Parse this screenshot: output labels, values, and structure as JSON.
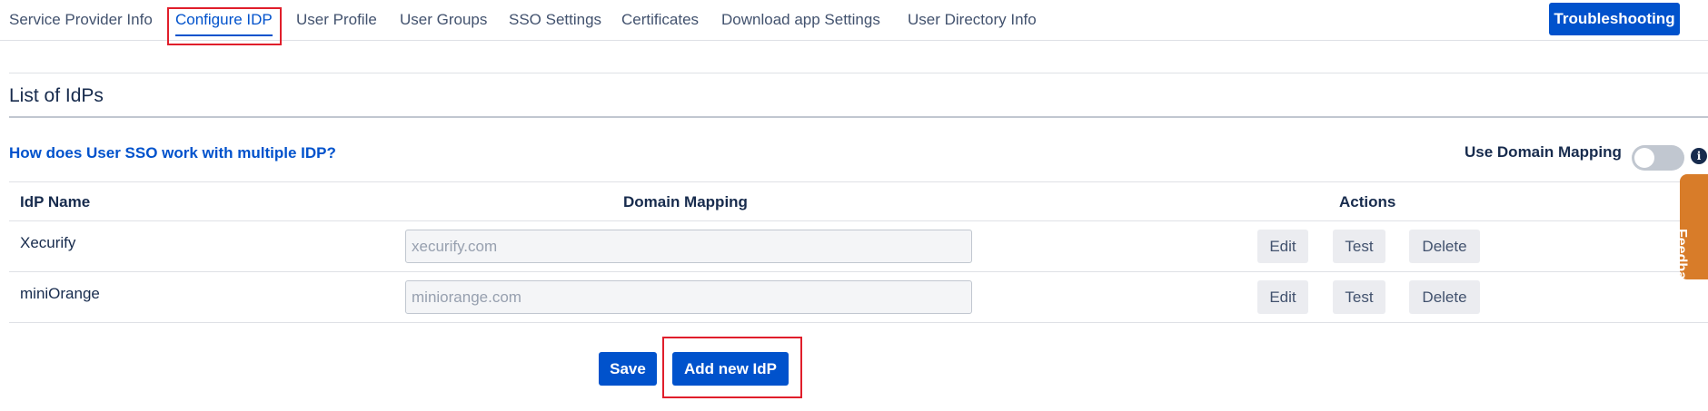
{
  "nav": {
    "tabs": [
      {
        "label": "Service Provider Info"
      },
      {
        "label": "Configure IDP"
      },
      {
        "label": "User Profile"
      },
      {
        "label": "User Groups"
      },
      {
        "label": "SSO Settings"
      },
      {
        "label": "Certificates"
      },
      {
        "label": "Download app Settings"
      },
      {
        "label": "User Directory Info"
      }
    ],
    "active_tab": "Configure IDP",
    "troubleshooting_label": "Troubleshooting"
  },
  "section": {
    "title": "List of IdPs",
    "help_link": "How does User SSO work with multiple IDP?",
    "use_domain_mapping_label": "Use Domain Mapping",
    "use_domain_mapping_on": false
  },
  "table": {
    "headers": {
      "name": "IdP Name",
      "domain": "Domain Mapping",
      "actions": "Actions"
    },
    "rows": [
      {
        "name": "Xecurify",
        "domain_placeholder": "xecurify.com",
        "edit": "Edit",
        "test": "Test",
        "delete": "Delete"
      },
      {
        "name": "miniOrange",
        "domain_placeholder": "miniorange.com",
        "edit": "Edit",
        "test": "Test",
        "delete": "Delete"
      }
    ]
  },
  "footer": {
    "save_label": "Save",
    "add_idp_label": "Add new IdP"
  },
  "feedback_label": "Feedback",
  "colors": {
    "primary": "#0052cc",
    "highlight": "#e01e2b",
    "feedback": "#d87c29"
  },
  "icons": {
    "info": "info-icon"
  }
}
